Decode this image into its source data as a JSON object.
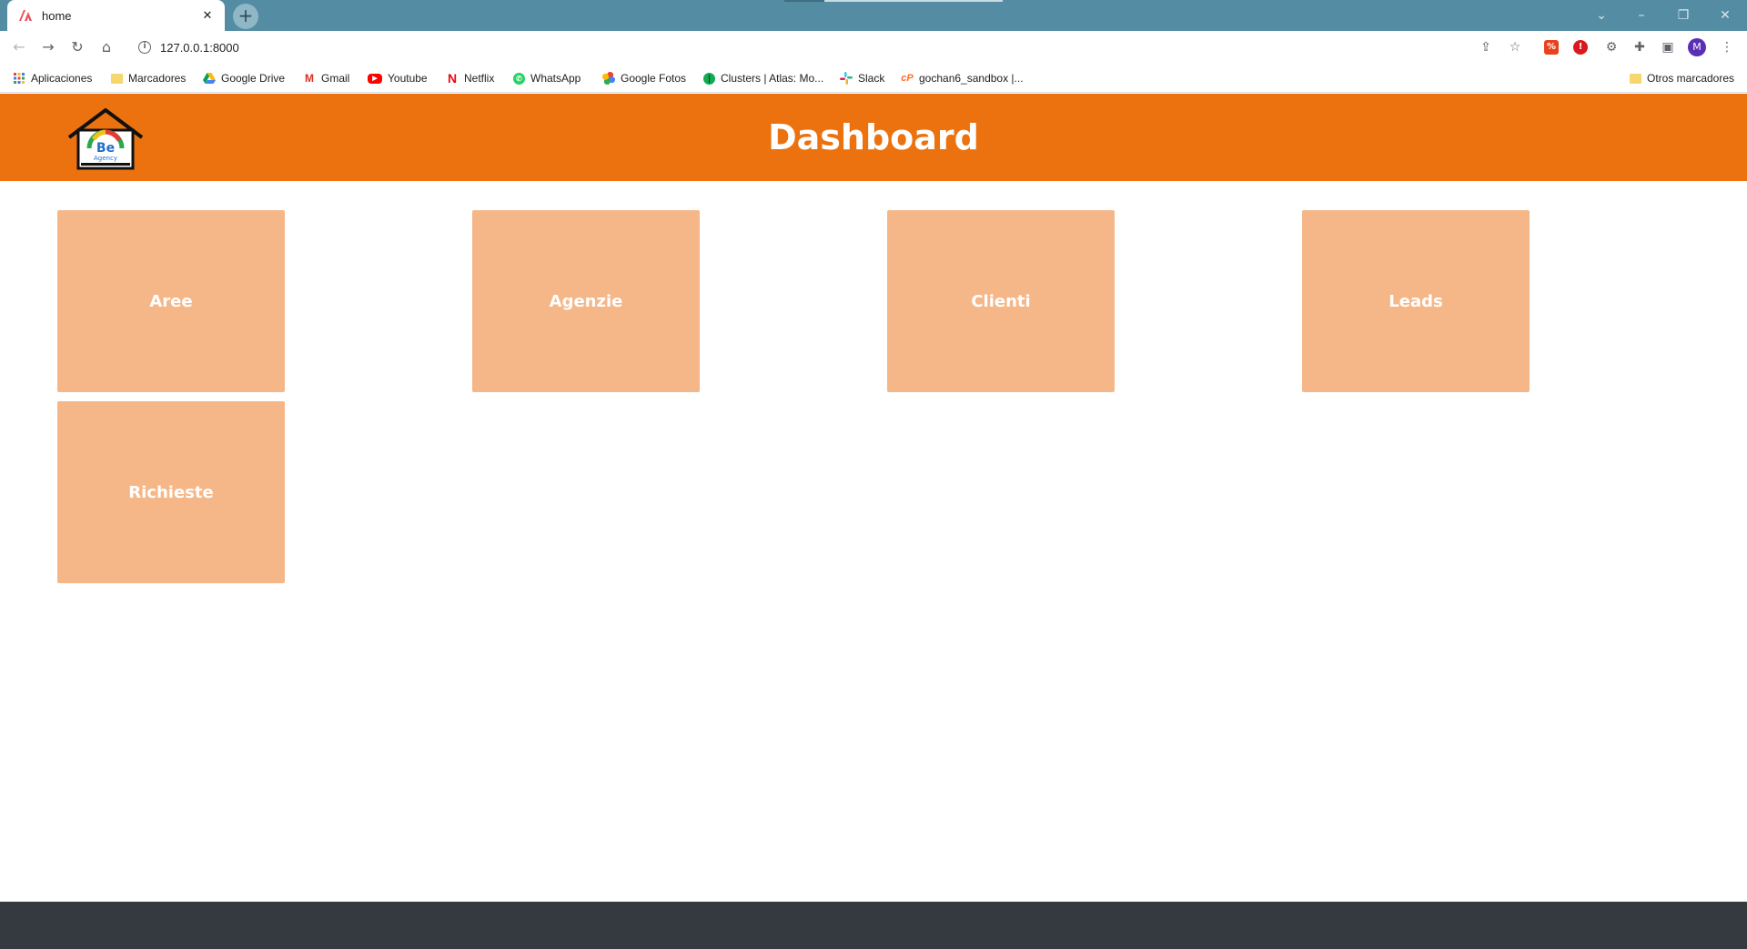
{
  "browser": {
    "tab_title": "home",
    "url": "127.0.0.1:8000",
    "bookmarks": [
      {
        "label": "Aplicaciones",
        "icon": "apps-grid-icon"
      },
      {
        "label": "Marcadores",
        "icon": "folder-icon"
      },
      {
        "label": "Google Drive",
        "icon": "google-drive-icon"
      },
      {
        "label": "Gmail",
        "icon": "gmail-icon"
      },
      {
        "label": "Youtube",
        "icon": "youtube-icon"
      },
      {
        "label": "Netflix",
        "icon": "netflix-icon"
      },
      {
        "label": "WhatsApp",
        "icon": "whatsapp-icon"
      },
      {
        "label": "Google Fotos",
        "icon": "google-photos-icon"
      },
      {
        "label": "Clusters | Atlas: Mo...",
        "icon": "mongodb-icon"
      },
      {
        "label": "Slack",
        "icon": "slack-icon"
      },
      {
        "label": "gochan6_sandbox |...",
        "icon": "cpanel-icon"
      }
    ],
    "other_bookmarks": "Otros marcadores",
    "profile_initial": "M"
  },
  "header": {
    "title": "Dashboard",
    "color": "#eb720e"
  },
  "cards": [
    {
      "label": "Aree"
    },
    {
      "label": "Agenzie"
    },
    {
      "label": "Clienti"
    },
    {
      "label": "Leads"
    },
    {
      "label": "Richieste"
    }
  ],
  "colors": {
    "card": "#f5b788",
    "footer": "#343a40",
    "tabstrip": "#548da3"
  }
}
